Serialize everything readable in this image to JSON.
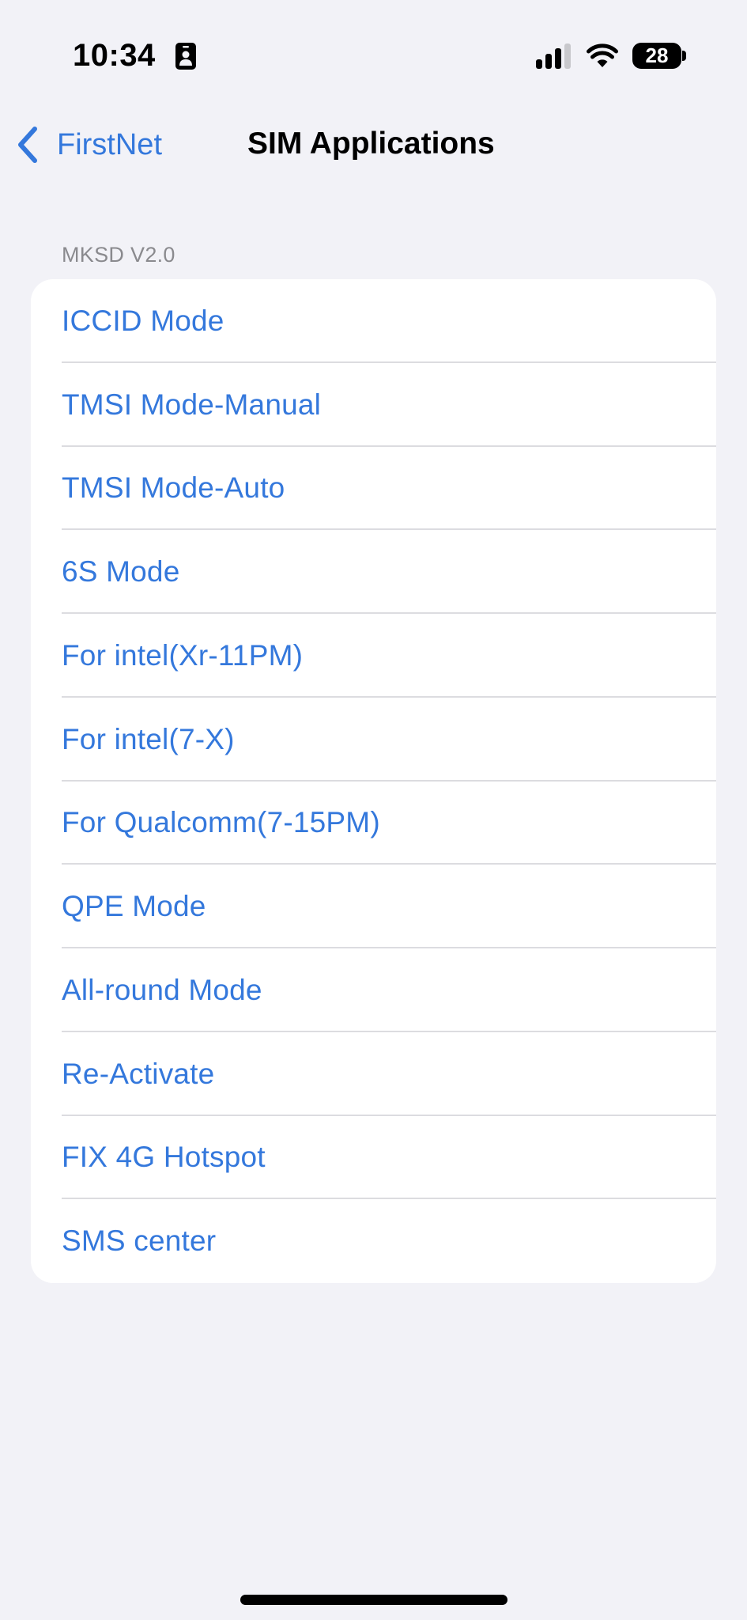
{
  "status_bar": {
    "time": "10:34",
    "battery_level": "28",
    "icons": [
      "contact-badge-icon",
      "cellular-signal-icon",
      "wifi-icon",
      "battery-icon"
    ],
    "signal_bars_active": 3,
    "signal_bars_total": 4
  },
  "nav": {
    "back_label": "FirstNet",
    "title": "SIM Applications"
  },
  "section": {
    "header": "MKSD V2.0",
    "items": [
      {
        "label": "ICCID Mode"
      },
      {
        "label": "TMSI Mode-Manual"
      },
      {
        "label": "TMSI Mode-Auto"
      },
      {
        "label": "6S Mode"
      },
      {
        "label": "For intel(Xr-11PM)"
      },
      {
        "label": "For intel(7-X)"
      },
      {
        "label": "For Qualcomm(7-15PM)"
      },
      {
        "label": "QPE Mode"
      },
      {
        "label": "All-round Mode"
      },
      {
        "label": "Re-Activate"
      },
      {
        "label": "FIX 4G Hotspot"
      },
      {
        "label": "SMS center"
      }
    ]
  },
  "colors": {
    "accent": "#3478DC",
    "background": "#F2F2F7",
    "card": "#FFFFFF",
    "separator": "#DCDCE0",
    "secondary_text": "#8A8A8E"
  }
}
